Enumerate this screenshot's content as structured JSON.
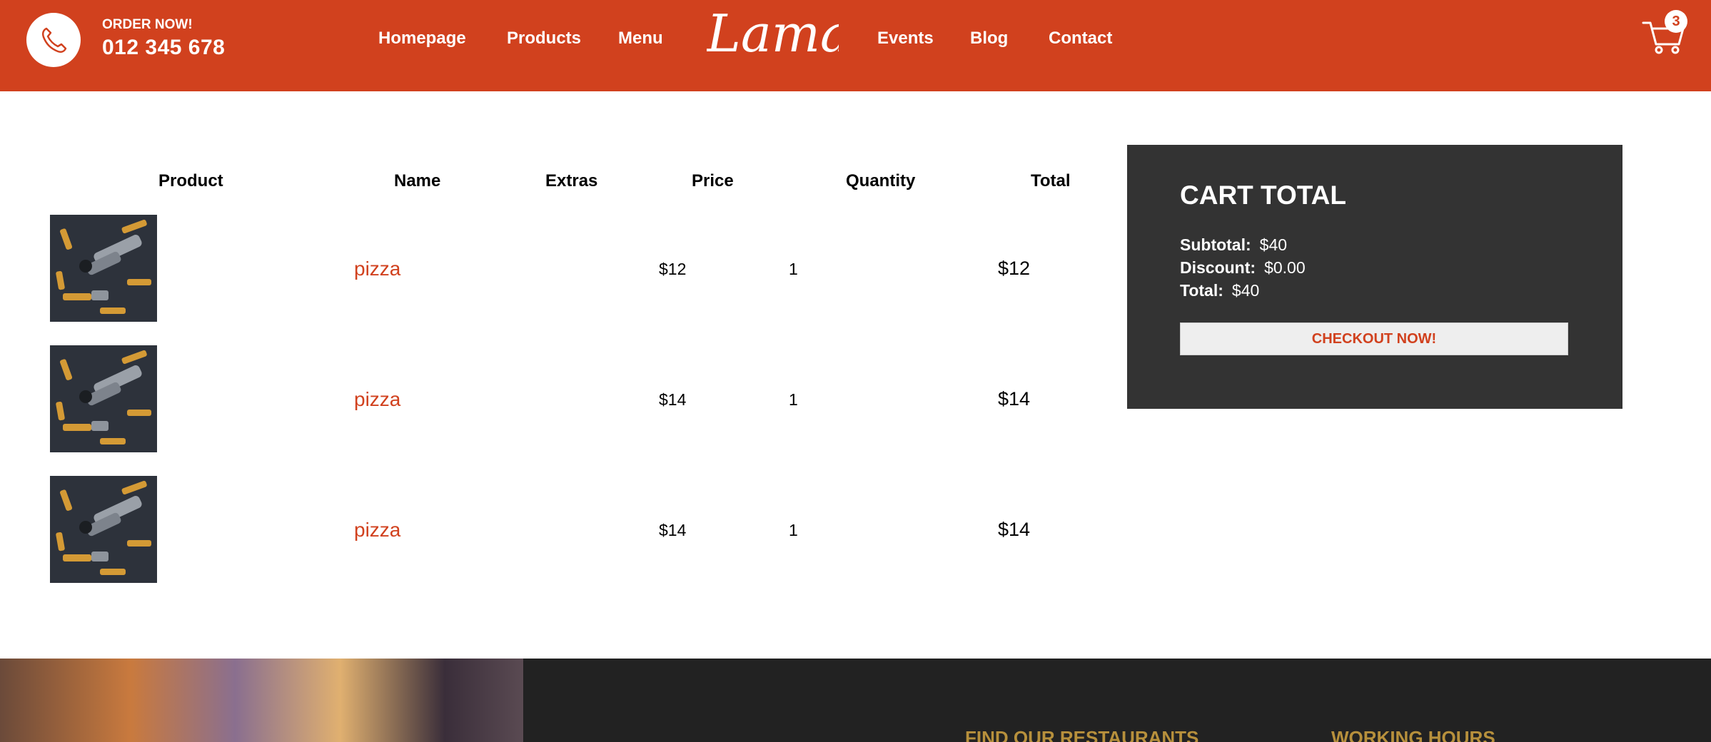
{
  "navbar": {
    "order_label": "ORDER NOW!",
    "phone": "012 345 678",
    "brand": "Lama",
    "cart_count": "3",
    "items_left": [
      "Homepage",
      "Products",
      "Menu"
    ],
    "items_right": [
      "Events",
      "Blog",
      "Contact"
    ]
  },
  "table": {
    "headers": [
      "Product",
      "Name",
      "Extras",
      "Price",
      "Quantity",
      "Total"
    ],
    "rows": [
      {
        "name": "pizza",
        "extras": "",
        "price": "$12",
        "quantity": "1",
        "total": "$12"
      },
      {
        "name": "pizza",
        "extras": "",
        "price": "$14",
        "quantity": "1",
        "total": "$14"
      },
      {
        "name": "pizza",
        "extras": "",
        "price": "$14",
        "quantity": "1",
        "total": "$14"
      }
    ]
  },
  "cart_total": {
    "title": "CART TOTAL",
    "subtotal_label": "Subtotal:",
    "subtotal_value": "$40",
    "discount_label": "Discount:",
    "discount_value": "$0.00",
    "total_label": "Total:",
    "total_value": "$40",
    "checkout_label": "CHECKOUT NOW!"
  },
  "footer": {
    "heading_restaurants": "FIND OUR RESTAURANTS",
    "heading_hours": "WORKING HOURS"
  },
  "colors": {
    "brand": "#d1411e",
    "dark_panel": "#333333",
    "footer_bg": "#222222",
    "footer_heading": "#b7903c"
  }
}
